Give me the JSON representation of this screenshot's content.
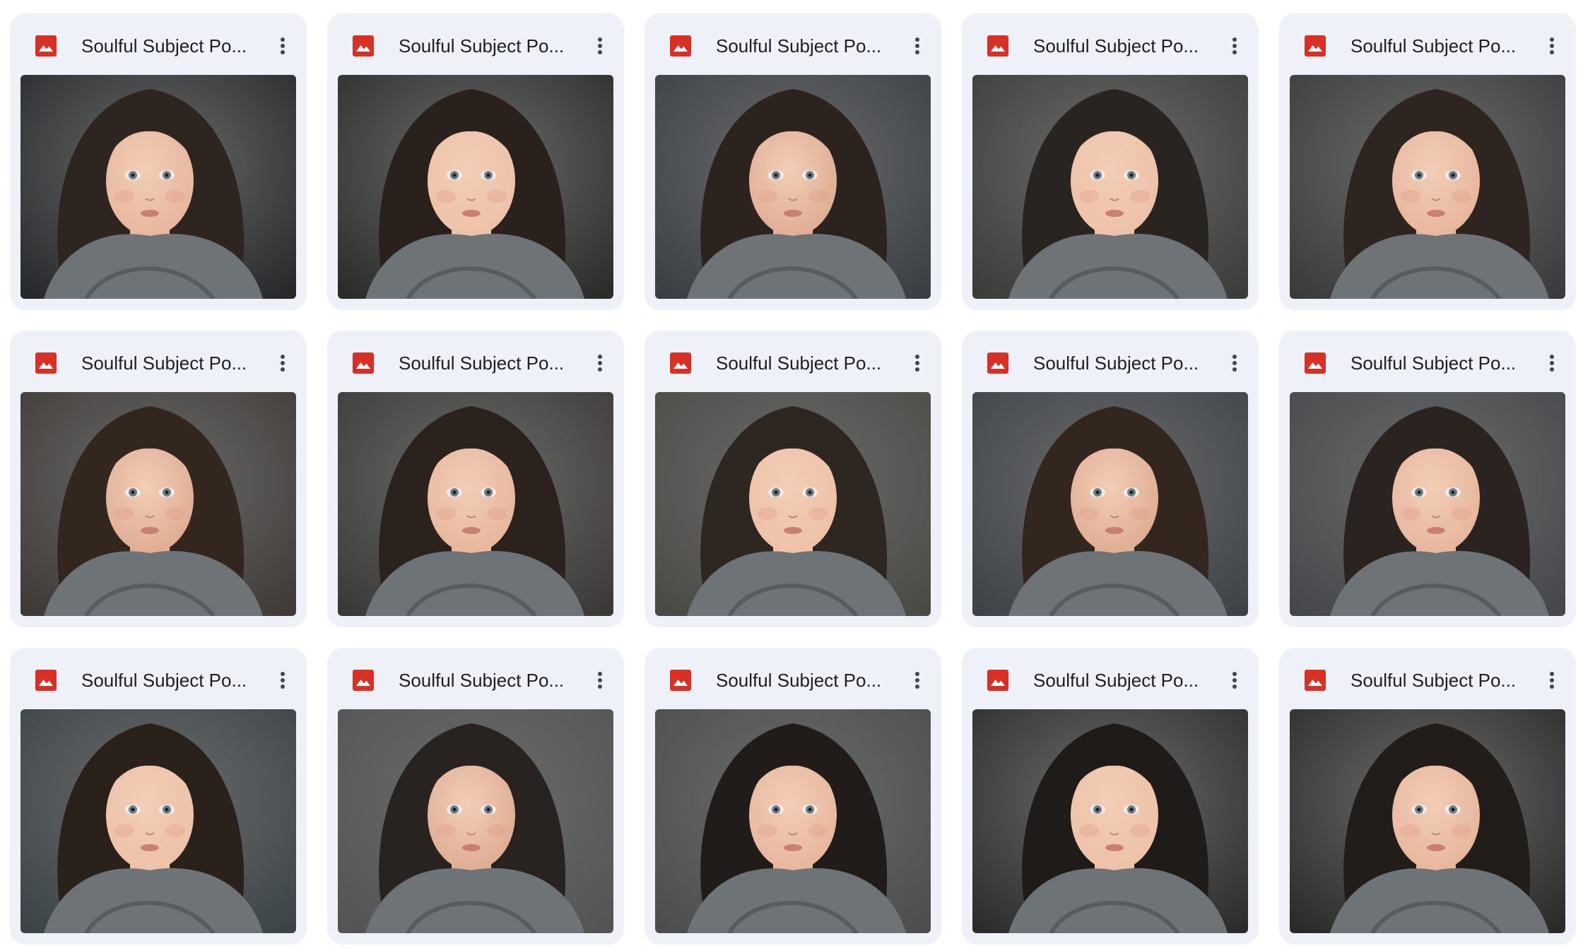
{
  "files": [
    {
      "name": "Soulful Subject Po...",
      "icon": "image-file-icon",
      "bg": "#262829",
      "hair": "#2f2520",
      "tone": 0
    },
    {
      "name": "Soulful Subject Po...",
      "icon": "image-file-icon",
      "bg": "#2b2b2a",
      "hair": "#2a211d",
      "tone": 1
    },
    {
      "name": "Soulful Subject Po...",
      "icon": "image-file-icon",
      "bg": "#3a3f44",
      "hair": "#2c231f",
      "tone": 2
    },
    {
      "name": "Soulful Subject Po...",
      "icon": "image-file-icon",
      "bg": "#3c3c3a",
      "hair": "#2a2420",
      "tone": 1
    },
    {
      "name": "Soulful Subject Po...",
      "icon": "image-file-icon",
      "bg": "#3a3b3a",
      "hair": "#2f2520",
      "tone": 0
    },
    {
      "name": "Soulful Subject Po...",
      "icon": "image-file-icon",
      "bg": "#3f3a36",
      "hair": "#33261f",
      "tone": 2
    },
    {
      "name": "Soulful Subject Po...",
      "icon": "image-file-icon",
      "bg": "#3b3938",
      "hair": "#2b221e",
      "tone": 0
    },
    {
      "name": "Soulful Subject Po...",
      "icon": "image-file-icon",
      "bg": "#4a4a45",
      "hair": "#2e2621",
      "tone": 1
    },
    {
      "name": "Soulful Subject Po...",
      "icon": "image-file-icon",
      "bg": "#3e4348",
      "hair": "#32261f",
      "tone": 2
    },
    {
      "name": "Soulful Subject Po...",
      "icon": "image-file-icon",
      "bg": "#45474a",
      "hair": "#2b231f",
      "tone": 0
    },
    {
      "name": "Soulful Subject Po...",
      "icon": "image-file-icon",
      "bg": "#3c4447",
      "hair": "#2a211b",
      "tone": 1
    },
    {
      "name": "Soulful Subject Po...",
      "icon": "image-file-icon",
      "bg": "#545454",
      "hair": "#282220",
      "tone": 2
    },
    {
      "name": "Soulful Subject Po...",
      "icon": "image-file-icon",
      "bg": "#4d4d4d",
      "hair": "#211c1a",
      "tone": 0
    },
    {
      "name": "Soulful Subject Po...",
      "icon": "image-file-icon",
      "bg": "#2c2c2c",
      "hair": "#1f1b19",
      "tone": 1
    },
    {
      "name": "Soulful Subject Po...",
      "icon": "image-file-icon",
      "bg": "#2a2a29",
      "hair": "#231d1a",
      "tone": 0
    }
  ],
  "more_icon": "more-vert-icon",
  "colors": {
    "card_bg": "#eef1f7",
    "icon_red": "#d93025",
    "title_text": "#1f1f1f",
    "scarf": "#6e7378",
    "skin": [
      "#e7b79d",
      "#edc2a8",
      "#dfae94"
    ]
  }
}
